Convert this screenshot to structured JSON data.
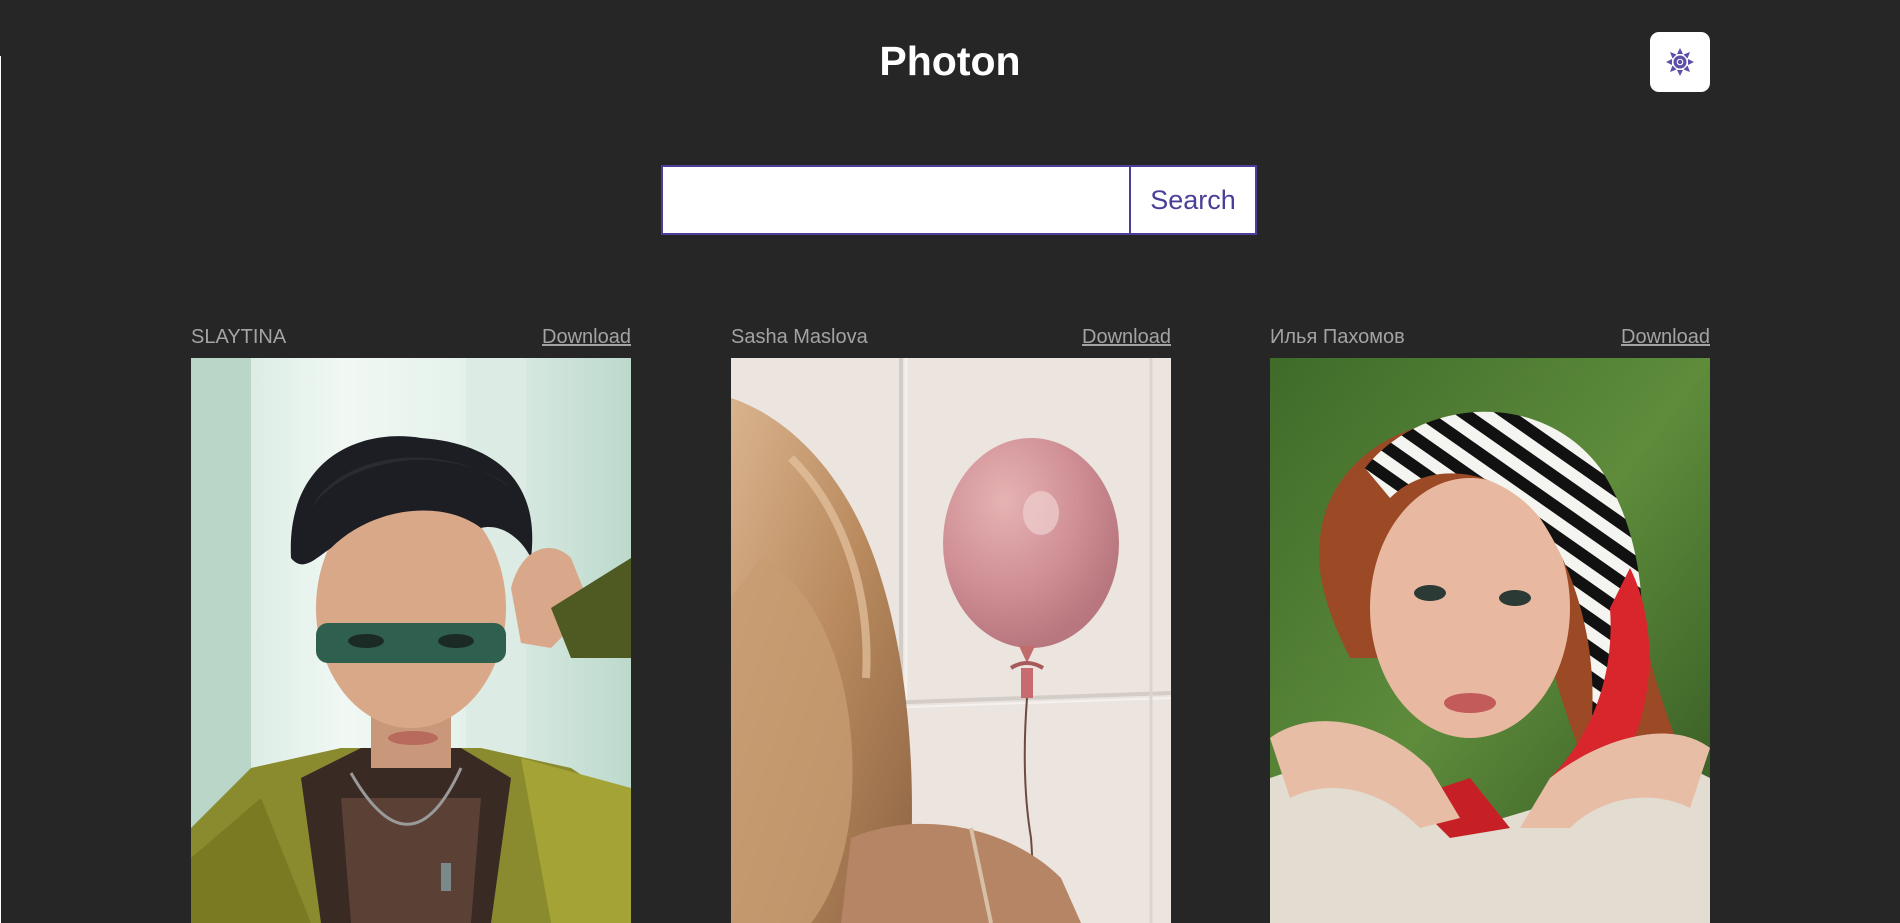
{
  "header": {
    "title": "Photon",
    "theme_toggle_icon": "sun-icon"
  },
  "search": {
    "value": "",
    "placeholder": "",
    "button_label": "Search"
  },
  "photos": [
    {
      "author": "SLAYTINA",
      "download_label": "Download"
    },
    {
      "author": "Sasha Maslova",
      "download_label": "Download"
    },
    {
      "author": "Илья Пахомов",
      "download_label": "Download"
    }
  ],
  "colors": {
    "background": "#262626",
    "accent": "#4a3f98",
    "muted_text": "#a3a3a3"
  }
}
